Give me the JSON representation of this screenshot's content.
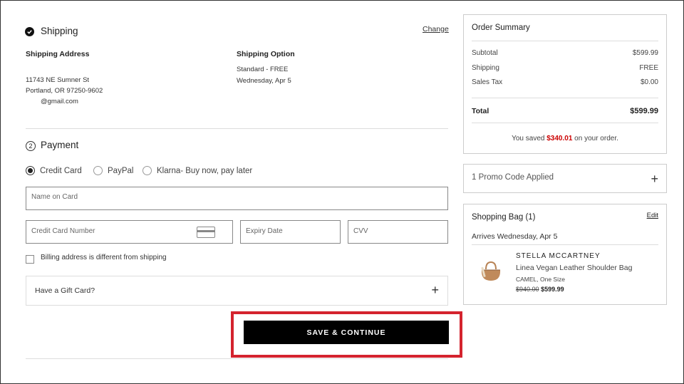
{
  "shipping": {
    "title": "Shipping",
    "change_label": "Change",
    "address_label": "Shipping Address",
    "address_lines": [
      "11743 NE Sumner St",
      "Portland, OR 97250-9602",
      "@gmail.com"
    ],
    "option_label": "Shipping Option",
    "option_lines": [
      "Standard - FREE",
      "Wednesday, Apr 5"
    ]
  },
  "payment": {
    "step": "2",
    "title": "Payment",
    "methods": [
      "Credit Card",
      "PayPal",
      "Klarna- Buy now, pay later"
    ],
    "selected_method": "Credit Card",
    "name_placeholder": "Name on Card",
    "card_number_placeholder": "Credit Card Number",
    "expiry_placeholder": "Expiry Date",
    "cvv_placeholder": "CVV",
    "billing_checkbox_label": "Billing address is different from shipping",
    "gift_card_label": "Have a Gift Card?",
    "save_button": "SAVE & CONTINUE"
  },
  "order_summary": {
    "title": "Order Summary",
    "rows": [
      {
        "label": "Subtotal",
        "value": "$599.99"
      },
      {
        "label": "Shipping",
        "value": "FREE"
      },
      {
        "label": "Sales Tax",
        "value": "$0.00"
      }
    ],
    "total_label": "Total",
    "total_value": "$599.99",
    "saved_prefix": "You saved",
    "saved_amount": "$340.01",
    "saved_suffix": "on your order."
  },
  "promo": {
    "label": "1 Promo Code Applied"
  },
  "bag": {
    "title": "Shopping Bag (1)",
    "edit_label": "Edit",
    "arrives": "Arrives Wednesday, Apr 5",
    "item": {
      "brand": "STELLA MCCARTNEY",
      "name": "Linea Vegan Leather Shoulder Bag",
      "variant": "CAMEL, One Size",
      "original_price": "$940.00",
      "sale_price": "$599.99"
    }
  },
  "colors": {
    "accent_red": "#c00000",
    "highlight_border": "#d4232e",
    "button_bg": "#000000"
  }
}
